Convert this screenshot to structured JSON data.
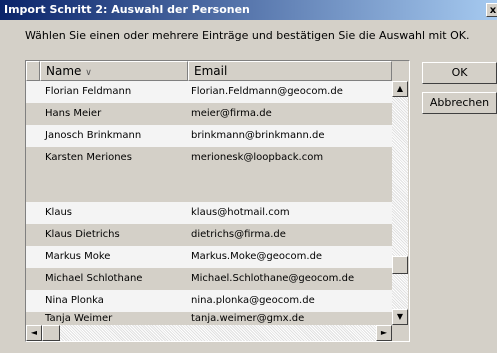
{
  "window": {
    "title": "Import Schritt 2: Auswahl der Personen",
    "close_glyph": "x",
    "instruction": "Wählen Sie einen oder mehrere Einträge und bestätigen Sie die Auswahl mit OK."
  },
  "table": {
    "columns": {
      "name": "Name",
      "sort_indicator": "∨",
      "email": "Email"
    },
    "rows": [
      {
        "name": "Florian Feldmann",
        "email": "Florian.Feldmann@geocom.de"
      },
      {
        "name": "Hans Meier",
        "email": "meier@firma.de"
      },
      {
        "name": "Janosch Brinkmann",
        "email": "brinkmann@brinkmann.de"
      },
      {
        "name": "Karsten Meriones",
        "email": "merionesk@loopback.com"
      },
      {
        "name": "Klaus",
        "email": "klaus@hotmail.com"
      },
      {
        "name": "Klaus Dietrichs",
        "email": "dietrichs@firma.de"
      },
      {
        "name": "Markus Moke",
        "email": "Markus.Moke@geocom.de"
      },
      {
        "name": "Michael Schlothane",
        "email": "Michael.Schlothane@geocom.de"
      },
      {
        "name": "Nina Plonka",
        "email": "nina.plonka@geocom.de"
      },
      {
        "name": "Tanja Weimer",
        "email": "tanja.weimer@gmx.de"
      }
    ]
  },
  "buttons": {
    "ok": "OK",
    "cancel": "Abbrechen"
  },
  "scroll": {
    "up": "▲",
    "down": "▼",
    "left": "◄",
    "right": "►"
  }
}
